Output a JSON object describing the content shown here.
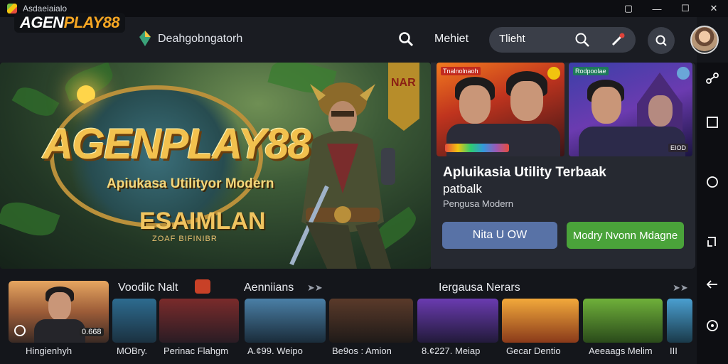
{
  "window": {
    "title": "Asdaeiaialo",
    "controls": [
      "▢",
      "—",
      "☐",
      "✕"
    ]
  },
  "header": {
    "logo_a": "AGEN",
    "logo_b": "PLAY88",
    "nav_title": "Deahgobngatorh",
    "link": "Mehiet",
    "search": {
      "value": "Tlieht"
    }
  },
  "hero": {
    "title": "AGENPLAY88",
    "subtitle": "Apiukasa Utilityor Modern",
    "banner": "ESAIMLAN",
    "banner_sub": "ZOAF BIFINIBR",
    "flag_text": "NAR",
    "colors": {
      "gold": "#f2c14e",
      "jungle": "#3c5a37"
    }
  },
  "side": {
    "card_a_tag": "Tnalnolnaoh",
    "card_b_tag": "Rodpoolae",
    "card_b_badge": "EIOD",
    "title": "Apluikasia Utility Terbaak",
    "title2": "patbalk",
    "subtitle": "Pengusa Modern",
    "btn_primary": "Nita U OW",
    "btn_secondary": "Modry Nvonn Mdagne",
    "colors": {
      "primary": "#5872a6",
      "secondary": "#4aa33a"
    }
  },
  "rows": {
    "heading_1": "Voodilc Nalt",
    "heading_2": "Aenniians",
    "heading_3": "Iergausa Nerars",
    "featured": {
      "label": "Hingienhyh",
      "badge": "0.668"
    },
    "thumbs": [
      {
        "label": "MOBry."
      },
      {
        "label": "Perinac Flahgm"
      },
      {
        "label": "A.¢99. Weipo"
      },
      {
        "label": "Be9os : Amion"
      },
      {
        "label": "8.¢227. Meiap"
      },
      {
        "label": "Gecar Dentio"
      },
      {
        "label": "Aeeaags Melim"
      },
      {
        "label": "III"
      }
    ]
  }
}
